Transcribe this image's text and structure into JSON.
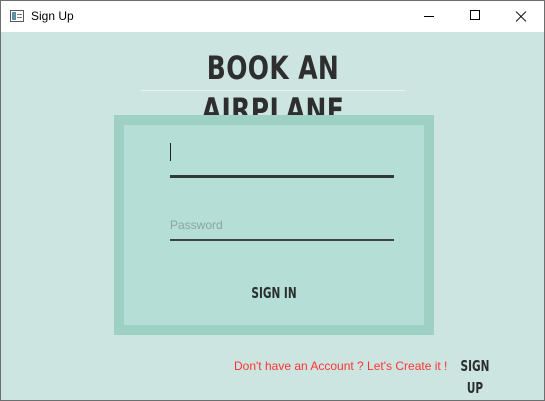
{
  "window": {
    "title": "Sign Up",
    "controls": [
      "minimize",
      "maximize",
      "close"
    ]
  },
  "heading": "BOOK AN AIRPLANE",
  "form": {
    "username_value": "",
    "password_placeholder": "Password",
    "signin_label": "SIGN IN"
  },
  "footer": {
    "prompt_text": "Don't have an Account ? Let's Create it !",
    "signup_label": "SIGN UP"
  },
  "colors": {
    "background": "#cce5e0",
    "card_border": "#9ed1c4",
    "card_fill": "#b5dfd6",
    "footer_text": "#ff3333"
  }
}
